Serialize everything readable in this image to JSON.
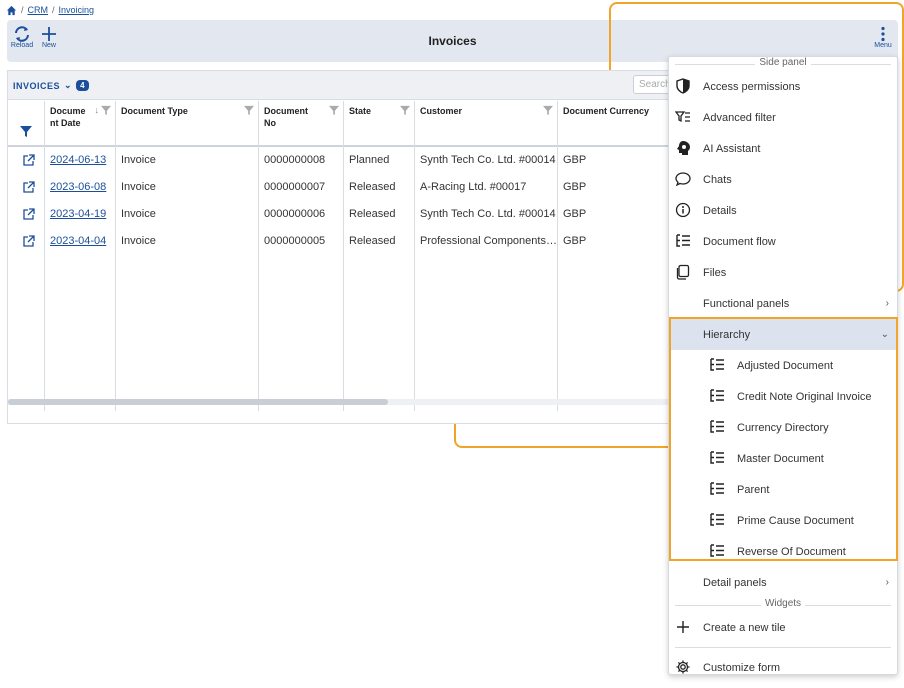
{
  "breadcrumb": {
    "sep": "/",
    "items": [
      "CRM",
      "Invoicing"
    ]
  },
  "toolbar": {
    "reload_label": "Reload",
    "new_label": "New",
    "title": "Invoices",
    "menu_label": "Menu"
  },
  "grid": {
    "title": "INVOICES",
    "count": "4",
    "search_placeholder": "Search",
    "columns": [
      "Docume nt Date",
      "Document Type",
      "Document No",
      "State",
      "Customer",
      "Document Currency"
    ],
    "rows": [
      {
        "date": "2024-06-13",
        "type": "Invoice",
        "no": "0000000008",
        "state": "Planned",
        "customer": "Synth Tech Co. Ltd. #00014",
        "currency": "GBP"
      },
      {
        "date": "2023-06-08",
        "type": "Invoice",
        "no": "0000000007",
        "state": "Released",
        "customer": "A-Racing Ltd. #00017",
        "currency": "GBP"
      },
      {
        "date": "2023-04-19",
        "type": "Invoice",
        "no": "0000000006",
        "state": "Released",
        "customer": "Synth Tech Co. Ltd. #00014",
        "currency": "GBP"
      },
      {
        "date": "2023-04-04",
        "type": "Invoice",
        "no": "0000000005",
        "state": "Released",
        "customer": "Professional Components Ltd.",
        "currency": "GBP"
      }
    ]
  },
  "menu": {
    "side_panel_label": "Side panel",
    "items": [
      "Access permissions",
      "Advanced filter",
      "AI Assistant",
      "Chats",
      "Details",
      "Document flow",
      "Files"
    ],
    "functional_panels": "Functional panels",
    "hierarchy": "Hierarchy",
    "hierarchy_items": [
      "Adjusted Document",
      "Credit Note Original Invoice",
      "Currency Directory",
      "Master Document",
      "Parent",
      "Prime Cause Document",
      "Reverse Of Document"
    ],
    "detail_panels": "Detail panels",
    "widgets_label": "Widgets",
    "create_tile": "Create a new tile",
    "customize_form": "Customize form"
  },
  "colors": {
    "accent": "#1b4f9c",
    "highlight": "#f0a52a",
    "toolbar_bg": "#e3e7ef"
  }
}
